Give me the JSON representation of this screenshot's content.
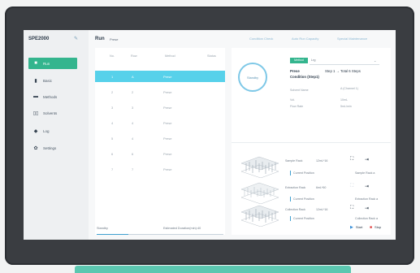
{
  "app": {
    "brand": "SPE2000",
    "page_title": "Run",
    "page_sub": "Prese"
  },
  "header_links": [
    "Condition Check",
    "Auto Run Capacity",
    "Special Maintenance"
  ],
  "sidebar": {
    "items": [
      {
        "label": "Run",
        "icon": "square-icon",
        "active": true
      },
      {
        "label": "Basic",
        "icon": "book-icon"
      },
      {
        "label": "Methods",
        "icon": "flask-icon"
      },
      {
        "label": "Solvents",
        "icon": "bottles-icon"
      },
      {
        "label": "Log",
        "icon": "chart-icon"
      },
      {
        "label": "Settings",
        "icon": "gear-icon"
      }
    ]
  },
  "table": {
    "headers": [
      "No.",
      "Row",
      "Method",
      "Status"
    ],
    "rows": [
      {
        "no": "1",
        "row": "A",
        "method": "Prese",
        "status": "",
        "selected": true
      },
      {
        "no": "2",
        "row": "2",
        "method": "Prese",
        "status": ""
      },
      {
        "no": "3",
        "row": "3",
        "method": "Prese",
        "status": ""
      },
      {
        "no": "4",
        "row": "4",
        "method": "Prese",
        "status": ""
      },
      {
        "no": "5",
        "row": "4",
        "method": "Prese",
        "status": ""
      },
      {
        "no": "6",
        "row": "6",
        "method": "Prese",
        "status": ""
      },
      {
        "no": "7",
        "row": "7",
        "method": "Prese",
        "status": ""
      }
    ]
  },
  "status_bar": {
    "left": "Standby",
    "right": "Estimated Duration(min):40",
    "progress": 0.25
  },
  "method_panel": {
    "state_label": "Standby",
    "method_button": "Method",
    "selected": "Lrg",
    "method_name": "Prese",
    "step_text": "Step 1 → Total 6 Steps",
    "condition": "Condition (Step1)",
    "fields": [
      {
        "key": "Solvent Name",
        "value": "A (Channel 1)"
      },
      {
        "key": "Vol.",
        "value": "10mL"
      },
      {
        "key": "Flow Rate",
        "value": "5mL/min"
      }
    ]
  },
  "racks": [
    {
      "label": "Sample Rack",
      "value": "12mL*16",
      "position": "Sample Rack a",
      "icon_faded": false
    },
    {
      "label": "Extraction Rack",
      "value": "6mL*60",
      "position": "Extraction Rack a",
      "icon_faded": true
    },
    {
      "label": "Collection Rack",
      "value": "12mL*16",
      "position": "Collection Rack a",
      "icon_faded": false
    }
  ],
  "current_position_label": "Current Position",
  "controls": {
    "start": "Start",
    "stop": "Stop"
  }
}
